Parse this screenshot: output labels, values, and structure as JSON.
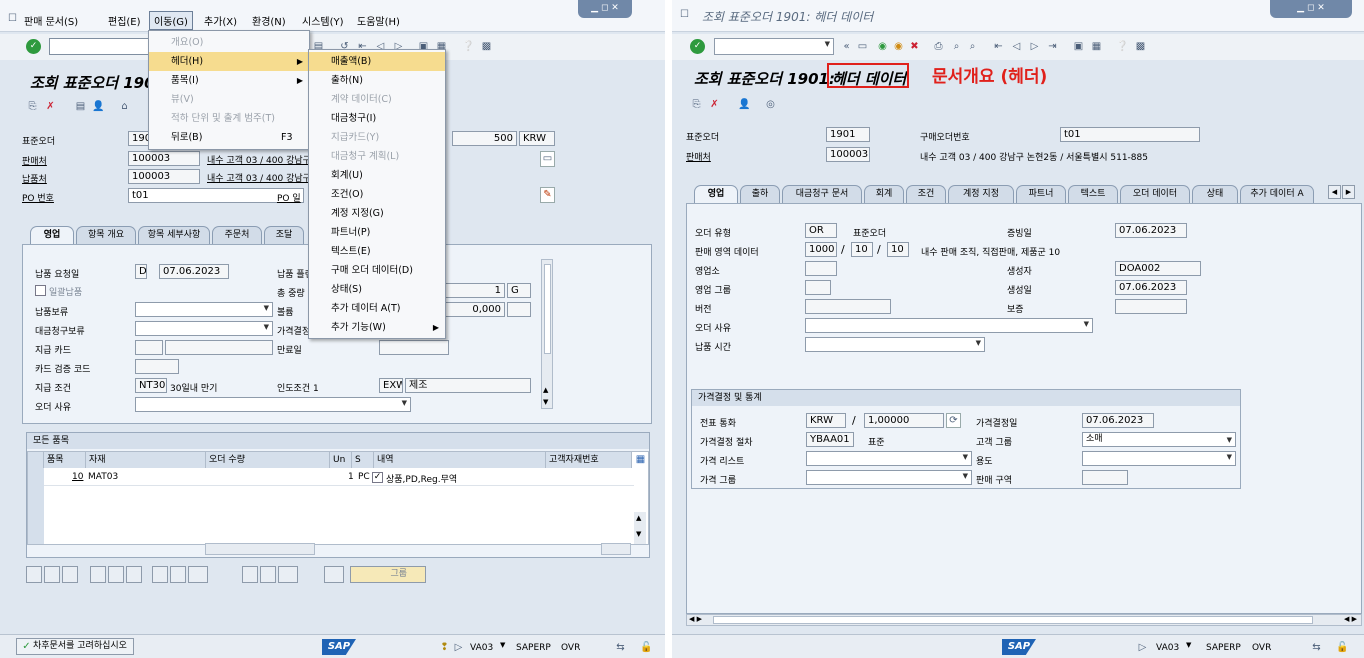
{
  "left": {
    "menubar": [
      "판매 문서(S)",
      "편집(E)",
      "이동(G)",
      "추가(X)",
      "환경(N)",
      "시스템(Y)",
      "도움말(H)"
    ],
    "title": "조회 표준오더 1901",
    "labels": {
      "std_order": "표준오더",
      "sold_to": "판매처",
      "ship_to": "납품처",
      "po_no": "PO 번호",
      "po_short": "PO 일"
    },
    "values": {
      "std_order": "190",
      "sold_to": "100003",
      "ship_to": "100003",
      "po_no": "t01",
      "net": "500",
      "currency": "KRW",
      "sold_to_desc": "내수 고객 03 / 400 강남구",
      "ship_to_desc": "내수 고객 03 / 400 강남구"
    },
    "tabs": [
      "영업",
      "항목 개요",
      "항목 세부사항",
      "주문처",
      "조달"
    ],
    "form": {
      "req_date_label": "납품 요청일",
      "req_date_prefix": "D",
      "req_date": "07.06.2023",
      "full_delivery": "일괄납품",
      "delivery_block": "납품보류",
      "billing_block": "대금청구보류",
      "pay_card": "지급 카드",
      "card_code": "카드 검증 코드",
      "pay_terms_label": "지급 조건",
      "pay_terms": "NT30",
      "pay_terms_desc": "30일내 만기",
      "order_reason": "오더 사유",
      "incoterms_label": "인도조건 1",
      "incoterms": "EXW",
      "incoterms_desc": "제조",
      "r_deliv": "납품 플랜",
      "r_weight": "총 중량",
      "r_volume": "볼륨",
      "r_pricing": "가격결정",
      "r_expiry": "만료일",
      "weight_val": "1",
      "weight_unit": "G",
      "volume_val": "0,000"
    },
    "items": {
      "header": "모든 품목",
      "cols": [
        "품목",
        "자재",
        "오더 수량",
        "Un",
        "S",
        "내역",
        "고객자재번호"
      ],
      "rows": [
        {
          "item": "10",
          "material": "MAT03",
          "qty": "1",
          "unit": "PC",
          "desc": "상품,PD,Reg.무역"
        }
      ]
    },
    "group_btn": "그룹",
    "status_msg": "차후문서를 고려하십시오",
    "status": {
      "tcode": "VA03",
      "system": "SAPERP",
      "mode": "OVR"
    },
    "menu": {
      "items": [
        {
          "label": "개요(O)",
          "dis": true
        },
        {
          "label": "헤더(H)",
          "hl": true,
          "sub": true
        },
        {
          "label": "품목(I)",
          "sub": true
        },
        {
          "label": "뷰(V)",
          "dis": true
        },
        {
          "label": "적하 단위 및 출계 범주(T)",
          "dis": true
        },
        {
          "label": "뒤로(B)",
          "key": "F3"
        }
      ],
      "sub": [
        {
          "label": "매출액(B)",
          "hl": true
        },
        {
          "label": "출하(N)"
        },
        {
          "label": "계약 데이터(C)",
          "dis": true
        },
        {
          "label": "대금청구(I)"
        },
        {
          "label": "지급카드(Y)",
          "dis": true
        },
        {
          "label": "대금청구 계획(L)",
          "dis": true
        },
        {
          "label": "회계(U)"
        },
        {
          "label": "조건(O)"
        },
        {
          "label": "계정 지정(G)"
        },
        {
          "label": "파트너(P)"
        },
        {
          "label": "텍스트(E)"
        },
        {
          "label": "구매 오더 데이터(D)"
        },
        {
          "label": "상태(S)"
        },
        {
          "label": "추가 데이터 A(T)"
        },
        {
          "label": "추가 기능(W)",
          "sub": true
        }
      ]
    }
  },
  "right": {
    "window_title": "조회 표준오더 1901: 헤더 데이터",
    "title_prefix": "조회 표준오더 1901:",
    "title_hl": "헤더 데이터",
    "annotation": "문서개요 (헤더)",
    "labels": {
      "std_order": "표준오더",
      "po_no": "구매오더번호",
      "sold_to": "판매처"
    },
    "values": {
      "std_order": "1901",
      "po_no": "t01",
      "sold_to": "100003",
      "sold_to_desc": "내수 고객 03 / 400 강남구 논현2동 / 서울특별시 511-885"
    },
    "tabs": [
      "영업",
      "출하",
      "대금청구 문서",
      "회계",
      "조건",
      "계정 지정",
      "파트너",
      "텍스트",
      "오더 데이터",
      "상태",
      "추가 데이터 A"
    ],
    "sales": {
      "order_type_label": "오더 유형",
      "order_type": "OR",
      "order_type_desc": "표준오더",
      "doc_date_label": "증빙일",
      "doc_date": "07.06.2023",
      "sales_area_label": "판매 영역 데이터",
      "sa1": "1000",
      "sa2": "10",
      "sa3": "10",
      "sa_desc": "내수 판매 조직, 직접판매, 제품군 10",
      "sales_office": "영업소",
      "created_by_label": "생성자",
      "created_by": "DOA002",
      "sales_group": "영업 그룹",
      "created_on_label": "생성일",
      "created_on": "07.06.2023",
      "version": "버전",
      "valid": "보증",
      "order_reason": "오더 사유",
      "delivery_time": "납품 시간"
    },
    "pricing": {
      "header": "가격결정 및 통계",
      "currency_label": "전표 통화",
      "currency": "KRW",
      "rate": "1,00000",
      "pricing_date_label": "가격결정일",
      "pricing_date": "07.06.2023",
      "procedure_label": "가격결정 절차",
      "procedure": "YBAA01",
      "procedure_desc": "표준",
      "cust_group_label": "고객 그룹",
      "cust_group": "소매",
      "price_list": "가격 리스트",
      "usage": "용도",
      "price_group": "가격 그룹",
      "sales_district": "판매 구역"
    },
    "status": {
      "tcode": "VA03",
      "system": "SAPERP",
      "mode": "OVR"
    }
  },
  "brand": "SAP"
}
